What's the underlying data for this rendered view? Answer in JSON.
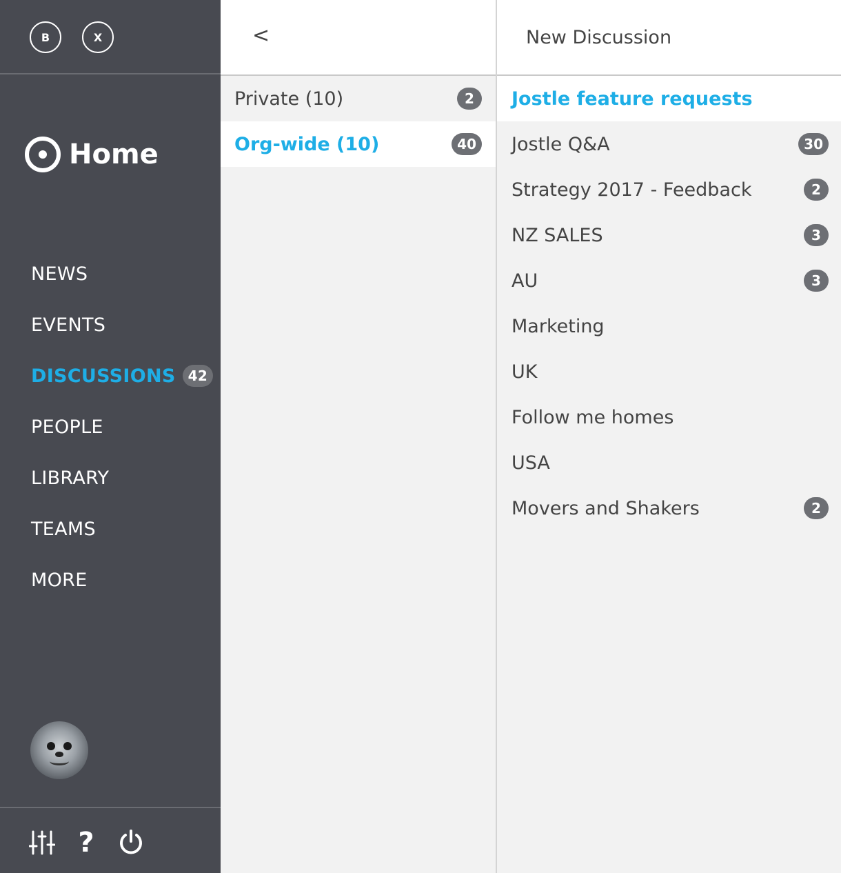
{
  "top_buttons": [
    {
      "label": "B"
    },
    {
      "label": "X"
    }
  ],
  "home": {
    "label": "Home"
  },
  "nav": [
    {
      "label": "NEWS",
      "badge": null,
      "active": false
    },
    {
      "label": "EVENTS",
      "badge": null,
      "active": false
    },
    {
      "label": "DISCUSSIONS",
      "badge": "42",
      "active": true
    },
    {
      "label": "PEOPLE",
      "badge": null,
      "active": false
    },
    {
      "label": "LIBRARY",
      "badge": null,
      "active": false
    },
    {
      "label": "TEAMS",
      "badge": null,
      "active": false
    },
    {
      "label": "MORE",
      "badge": null,
      "active": false
    }
  ],
  "bottom_icons": [
    "settings-sliders-icon",
    "help-icon",
    "power-icon"
  ],
  "bottom_help_glyph": "?",
  "middle": {
    "back_glyph": "<",
    "rows": [
      {
        "label": "Private (10)",
        "badge": "2",
        "active": false
      },
      {
        "label": "Org-wide (10)",
        "badge": "40",
        "active": true
      }
    ]
  },
  "right": {
    "header": "New Discussion",
    "rows": [
      {
        "label": "Jostle feature requests",
        "badge": null,
        "active": true
      },
      {
        "label": "Jostle Q&A",
        "badge": "30",
        "active": false
      },
      {
        "label": "Strategy 2017 - Feedback",
        "badge": "2",
        "active": false
      },
      {
        "label": "NZ SALES",
        "badge": "3",
        "active": false
      },
      {
        "label": "AU",
        "badge": "3",
        "active": false
      },
      {
        "label": "Marketing",
        "badge": null,
        "active": false
      },
      {
        "label": "UK",
        "badge": null,
        "active": false
      },
      {
        "label": "Follow me homes",
        "badge": null,
        "active": false
      },
      {
        "label": "USA",
        "badge": null,
        "active": false
      },
      {
        "label": "Movers and Shakers",
        "badge": "2",
        "active": false
      }
    ]
  },
  "colors": {
    "sidebar_bg": "#484a51",
    "accent": "#1eaee6",
    "badge_bg": "#6d6f74",
    "panel_bg": "#f2f2f2"
  }
}
